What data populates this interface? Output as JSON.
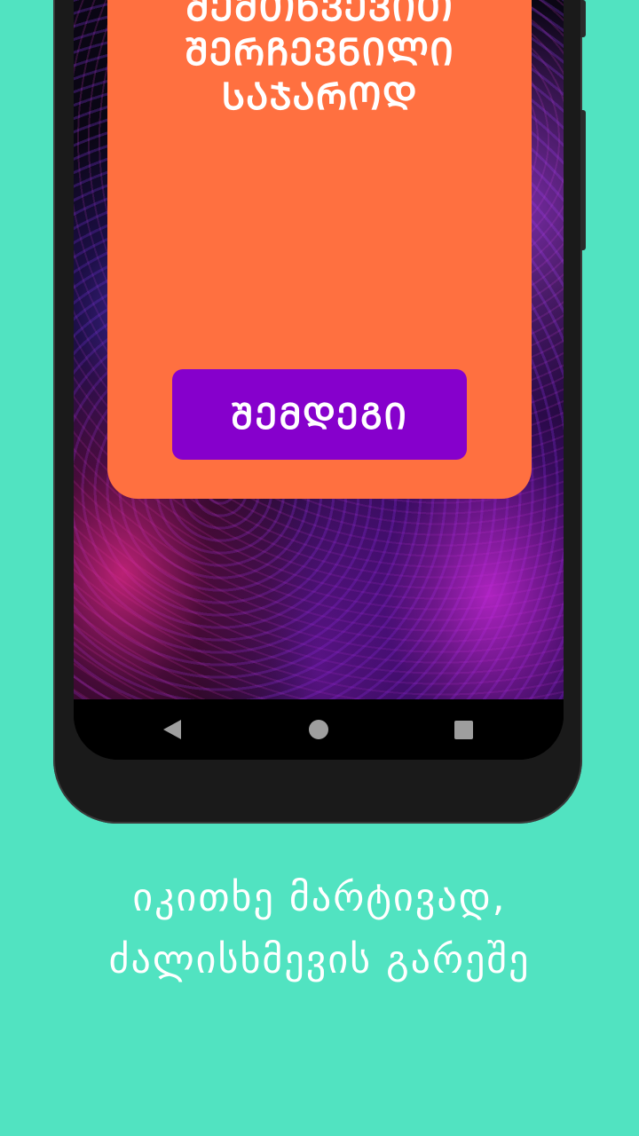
{
  "card": {
    "title_line1": "ᲨᲔᲛᲗᲮᲕᲔᲕᲘᲗ",
    "title_line2": "ᲨᲔᲠᲩᲔᲕᲜᲘᲚᲘ",
    "title_line3": "ᲡᲐᲯᲐᲠᲝᲓ"
  },
  "next_button": {
    "label": "ᲨᲔᲛᲓᲔᲒᲘ"
  },
  "caption": {
    "line1": "იკითხე მარტივად,",
    "line2": "ძალისხმევის გარეშე"
  },
  "colors": {
    "background": "#51e3c1",
    "card": "#ff7040",
    "button": "#8600cc"
  },
  "icons": {
    "back": "triangle-back-icon",
    "home": "circle-home-icon",
    "recent": "square-recent-icon"
  }
}
